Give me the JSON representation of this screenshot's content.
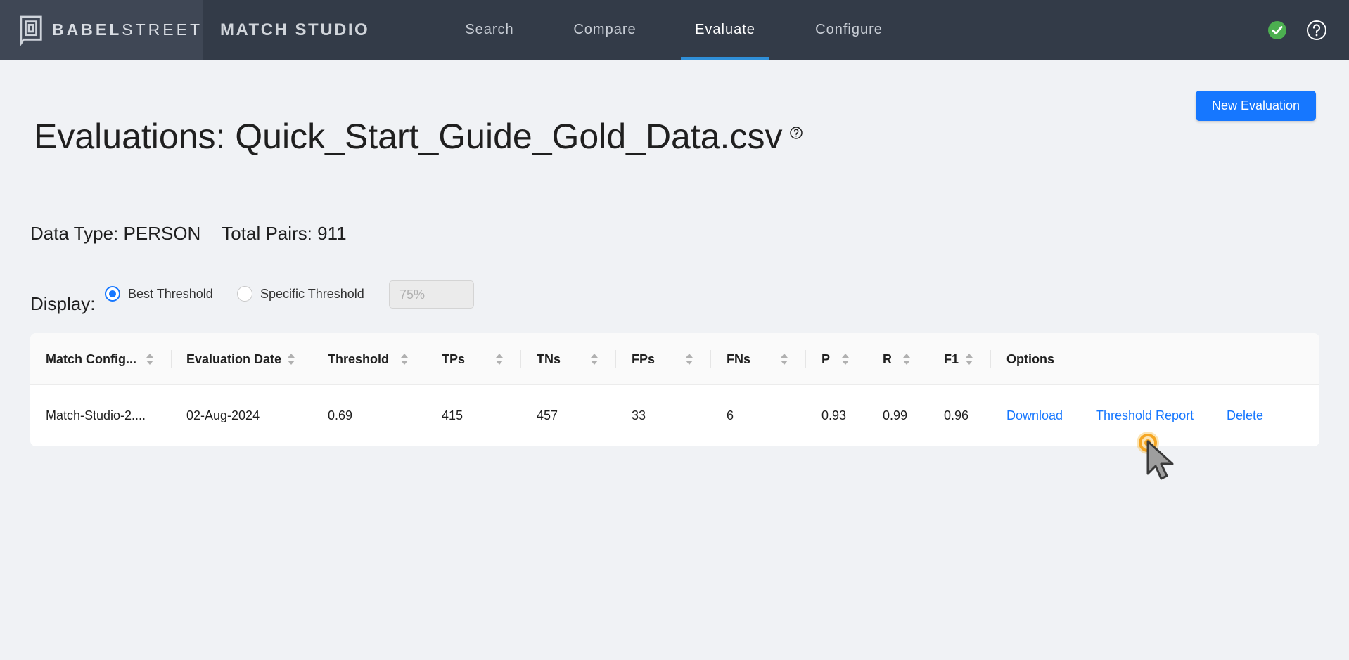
{
  "brand": {
    "name_bold": "BABEL",
    "name_rest": "STREET",
    "product": "MATCH STUDIO"
  },
  "nav": {
    "tabs": [
      {
        "label": "Search"
      },
      {
        "label": "Compare"
      },
      {
        "label": "Evaluate",
        "active": true
      },
      {
        "label": "Configure"
      }
    ]
  },
  "header": {
    "new_evaluation_label": "New Evaluation",
    "title": "Evaluations: Quick_Start_Guide_Gold_Data.csv"
  },
  "info": {
    "data_type": "Data Type: PERSON",
    "total_pairs": "Total Pairs: 911"
  },
  "display": {
    "label": "Display:",
    "options": [
      {
        "label": "Best Threshold",
        "checked": true
      },
      {
        "label": "Specific Threshold",
        "checked": false
      }
    ],
    "threshold_placeholder": "75%"
  },
  "table": {
    "columns": [
      "Match Config...",
      "Evaluation Date",
      "Threshold",
      "TPs",
      "TNs",
      "FPs",
      "FNs",
      "P",
      "R",
      "F1",
      "Options"
    ],
    "rows": [
      {
        "config": "Match-Studio-2....",
        "date": "02-Aug-2024",
        "threshold": "0.69",
        "tps": "415",
        "tns": "457",
        "fps": "33",
        "fns": "6",
        "p": "0.93",
        "r": "0.99",
        "f1": "0.96",
        "options": [
          "Download",
          "Threshold Report",
          "Delete"
        ]
      }
    ]
  },
  "colors": {
    "topbar": "#333b48",
    "accent": "#1677ff",
    "nav_active_underline": "#2f8fd8",
    "status_ok": "#4caf50"
  },
  "icons": {
    "status": "check-circle-icon",
    "help": "question-circle-icon"
  }
}
